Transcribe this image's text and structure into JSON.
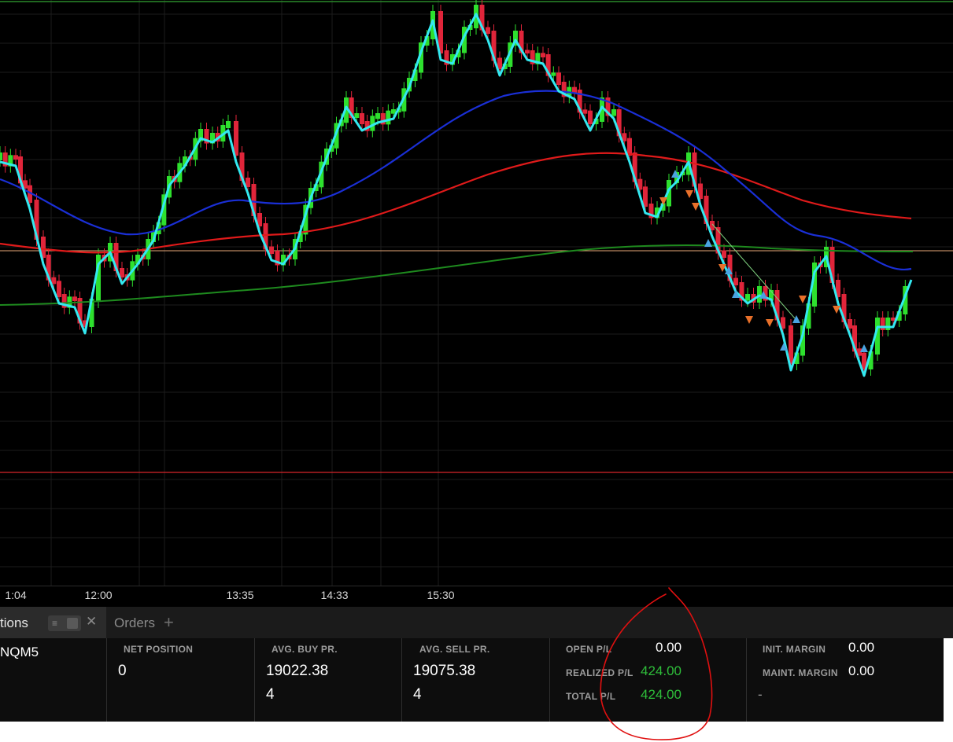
{
  "chart": {
    "time_ticks": [
      {
        "label": "1:04"
      },
      {
        "label": "12:00"
      },
      {
        "label": "13:35"
      },
      {
        "label": "14:33"
      },
      {
        "label": "15:30"
      }
    ],
    "colors": {
      "background": "#000000",
      "bull_candle": "#2ee02e",
      "bear_candle": "#e0253a",
      "fast_line": "#33e8f0",
      "ma_blue": "#1a2fd6",
      "ma_red": "#e01a1a",
      "ma_green": "#1e8a1e",
      "price_line": "#e8a878",
      "lower_line": "#d6252a",
      "buy_marker": "#4aa3e0",
      "sell_marker": "#e8702a"
    }
  },
  "tabs": {
    "active_label": "tions",
    "orders_label": "Orders",
    "add_label": "+",
    "close_label": "✕"
  },
  "positions": {
    "symbol": "NQM5",
    "net_position_header": "NET POSITION",
    "net_position_value": "0",
    "avg_buy_header": "AVG. BUY PR.",
    "avg_buy_value": "19022.38",
    "avg_buy_qty": "4",
    "avg_sell_header": "AVG. SELL PR.",
    "avg_sell_value": "19075.38",
    "avg_sell_qty": "4",
    "open_pl_label": "OPEN P/L",
    "open_pl_value": "0.00",
    "realized_pl_label": "REALIZED P/L",
    "realized_pl_value": "424.00",
    "total_pl_label": "TOTAL P/L",
    "total_pl_value": "424.00",
    "init_margin_label": "INIT. MARGIN",
    "init_margin_value": "0.00",
    "maint_margin_label": "MAINT. MARGIN",
    "maint_margin_value": "0.00",
    "margin_extra": "-"
  },
  "annotation_color": "#e01010"
}
